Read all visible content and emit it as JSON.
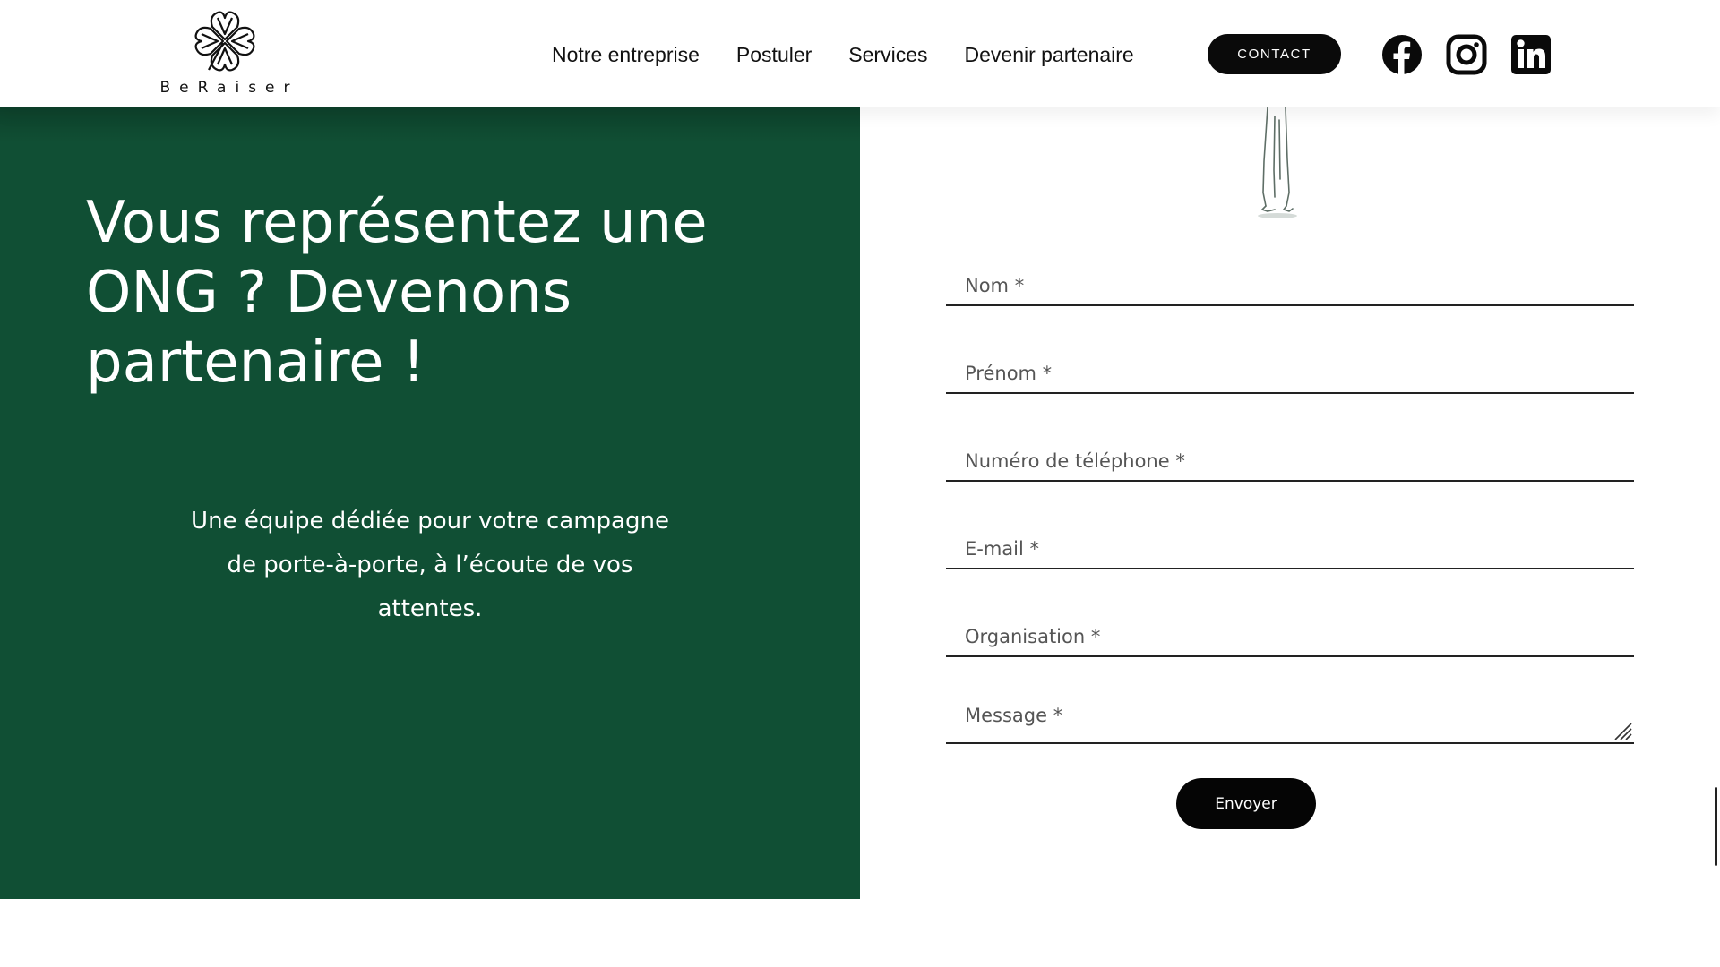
{
  "header": {
    "logo_text": "BeRaiser",
    "nav": [
      {
        "label": "Notre entreprise"
      },
      {
        "label": "Postuler"
      },
      {
        "label": "Services"
      },
      {
        "label": "Devenir partenaire"
      }
    ],
    "contact_label": "CONTACT",
    "social": [
      {
        "icon": "facebook-icon"
      },
      {
        "icon": "instagram-icon"
      },
      {
        "icon": "linkedin-icon"
      }
    ]
  },
  "hero": {
    "title": "Vous représentez une ONG ? Devenons partenaire !",
    "subtitle": "Une équipe dédiée pour votre campagne de porte-à-porte, à l’écoute de vos attentes.",
    "background": "#104f34"
  },
  "form": {
    "fields": [
      {
        "placeholder": "Nom *"
      },
      {
        "placeholder": "Prénom *"
      },
      {
        "placeholder": "Numéro de téléphone *"
      },
      {
        "placeholder": "E-mail *"
      },
      {
        "placeholder": "Organisation *"
      }
    ],
    "message_placeholder": "Message *",
    "submit_label": "Envoyer"
  }
}
